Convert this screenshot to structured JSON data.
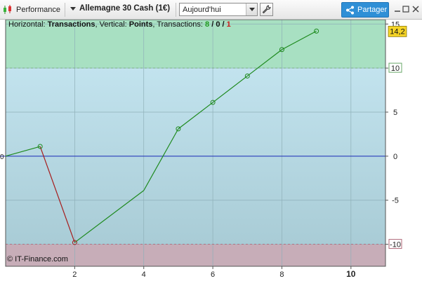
{
  "toolbar": {
    "performance_label": "Performance",
    "instrument": "Allemagne 30 Cash (1€)",
    "period_value": "Aujourd'hui",
    "share_label": "Partager"
  },
  "header": {
    "horizontal_prefix": "Horizontal: ",
    "horizontal_value": "Transactions",
    "vertical_prefix": ", Vertical: ",
    "vertical_value": "Points",
    "transactions_prefix": ", Transactions: ",
    "transactions_positive": "8",
    "transactions_neutral": "0",
    "transactions_negative": "1",
    "separator": " / "
  },
  "copyright": "© IT-Finance.com",
  "colors": {
    "profit_zone": "#a8e0c2",
    "normal_zone": "#bcdde8",
    "loss_zone": "#c7adb8",
    "gain_line": "#1e8a1e",
    "loss_line": "#a61c1c",
    "zero_line": "#1a2bb8",
    "last_value_bg": "#f5d426"
  },
  "chart_data": {
    "type": "line",
    "x": [
      0,
      1,
      2,
      4,
      5,
      6,
      7,
      8,
      9
    ],
    "y": [
      0,
      1.1,
      -9.8,
      -3.9,
      3.1,
      6.1,
      9.1,
      12.1,
      14.2
    ],
    "xlim": [
      0,
      11
    ],
    "ylim": [
      -12.5,
      15.5
    ],
    "x_ticks": [
      2,
      4,
      6,
      8,
      10
    ],
    "y_ticks": [
      15,
      10,
      5,
      0,
      -5,
      -10
    ],
    "zero_label": "0",
    "upper_level": 10,
    "lower_level": -10,
    "last_value": "14,2",
    "grid": true
  }
}
